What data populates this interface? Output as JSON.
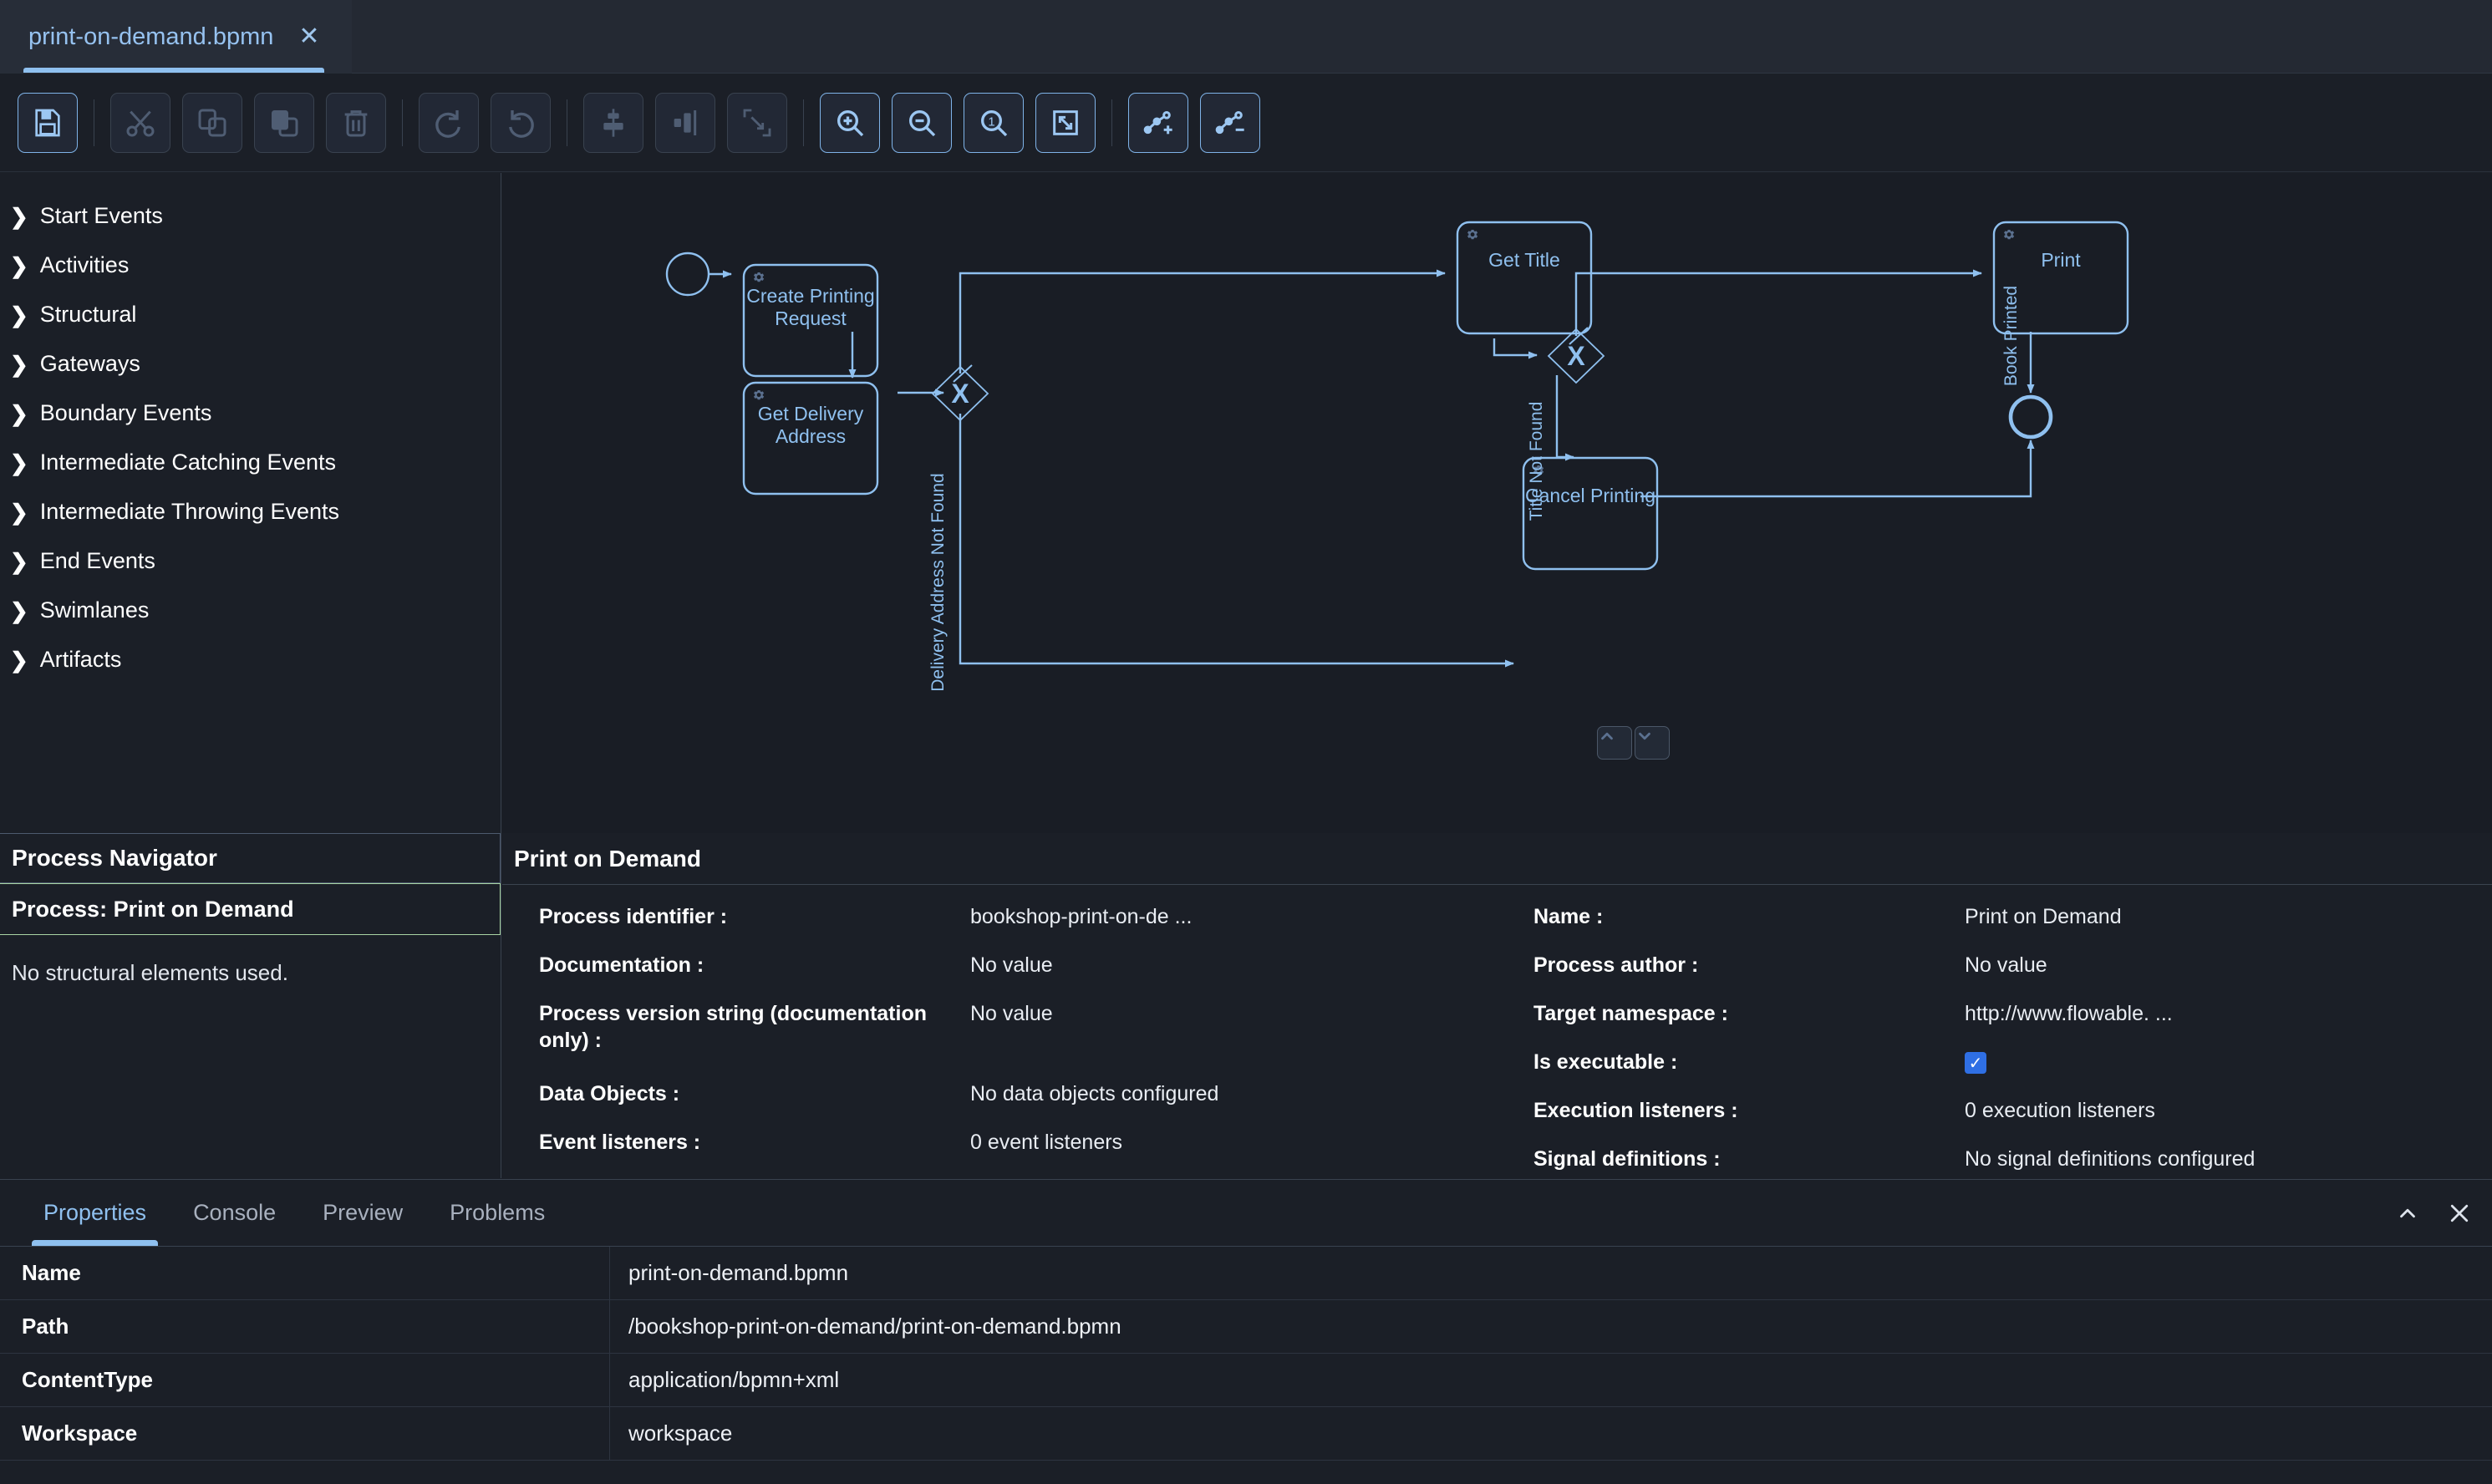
{
  "editor_tab": {
    "filename": "print-on-demand.bpmn",
    "close_icon": "close-icon"
  },
  "toolbar": {
    "buttons": [
      {
        "name": "save-button",
        "icon": "save-floppy-icon",
        "accent": true
      },
      {
        "name": "cut-button",
        "icon": "scissors-icon",
        "accent": false
      },
      {
        "name": "copy-button",
        "icon": "copy-icon",
        "accent": false
      },
      {
        "name": "paste-button",
        "icon": "paste-icon",
        "accent": false
      },
      {
        "name": "delete-button",
        "icon": "trash-icon",
        "accent": false
      },
      {
        "name": "redo-button",
        "icon": "redo-arrow-icon",
        "accent": false
      },
      {
        "name": "undo-button",
        "icon": "undo-arrow-icon",
        "accent": false
      },
      {
        "name": "align-vertical-button",
        "icon": "align-vertical-icon",
        "accent": false
      },
      {
        "name": "align-horizontal-button",
        "icon": "align-horizontal-icon",
        "accent": false
      },
      {
        "name": "resize-button",
        "icon": "resize-diagonal-icon",
        "accent": false
      },
      {
        "name": "zoom-in-button",
        "icon": "magnifier-plus-icon",
        "accent": true
      },
      {
        "name": "zoom-out-button",
        "icon": "magnifier-minus-icon",
        "accent": true
      },
      {
        "name": "zoom-actual-button",
        "icon": "magnifier-one-icon",
        "accent": true
      },
      {
        "name": "zoom-fit-button",
        "icon": "fit-to-screen-icon",
        "accent": true
      },
      {
        "name": "add-bendpoint-button",
        "icon": "node-plus-icon",
        "accent": true
      },
      {
        "name": "remove-bendpoint-button",
        "icon": "node-minus-icon",
        "accent": true
      }
    ]
  },
  "palette": {
    "items": [
      {
        "label": "Start Events"
      },
      {
        "label": "Activities"
      },
      {
        "label": "Structural"
      },
      {
        "label": "Gateways"
      },
      {
        "label": "Boundary Events"
      },
      {
        "label": "Intermediate Catching Events"
      },
      {
        "label": "Intermediate Throwing Events"
      },
      {
        "label": "End Events"
      },
      {
        "label": "Swimlanes"
      },
      {
        "label": "Artifacts"
      }
    ]
  },
  "navigator": {
    "header": "Process Navigator",
    "selected": "Process: Print on Demand",
    "empty_message": "No structural elements used."
  },
  "diagram": {
    "nodes": [
      {
        "id": "start",
        "type": "start-event",
        "label": ""
      },
      {
        "id": "create-printing-request",
        "type": "service-task",
        "label": "Create Printing\nRequest"
      },
      {
        "id": "get-delivery-address",
        "type": "service-task",
        "label": "Get Delivery\nAddress"
      },
      {
        "id": "gw-delivery",
        "type": "exclusive-gateway",
        "label": "X"
      },
      {
        "id": "get-title",
        "type": "service-task",
        "label": "Get Title"
      },
      {
        "id": "gw-title",
        "type": "exclusive-gateway",
        "label": "X"
      },
      {
        "id": "print",
        "type": "service-task",
        "label": "Print"
      },
      {
        "id": "cancel-printing",
        "type": "service-task",
        "label": "Cancel Printing"
      },
      {
        "id": "end",
        "type": "end-event",
        "label": ""
      }
    ],
    "flow_labels": [
      {
        "id": "delivery-address-not-found",
        "text": "Delivery Address Not Found"
      },
      {
        "id": "title-not-found",
        "text": "Title Not Found"
      },
      {
        "id": "book-printed",
        "text": "Book Printed"
      }
    ],
    "scroll_controls": [
      {
        "name": "scroll-up-button",
        "icon": "chevron-up-icon"
      },
      {
        "name": "scroll-down-button",
        "icon": "chevron-down-icon"
      }
    ]
  },
  "element_properties": {
    "title": "Print on Demand",
    "left_column": [
      {
        "key": "Process identifier :",
        "value": "bookshop-print-on-de ..."
      },
      {
        "key": "Documentation :",
        "value": "No value"
      },
      {
        "key": "Process version string (documentation only) :",
        "value": "No value"
      },
      {
        "key": "Data Objects :",
        "value": "No data objects configured"
      },
      {
        "key": "Event listeners :",
        "value": "0 event listeners"
      }
    ],
    "right_column": [
      {
        "key": "Name :",
        "value": "Print on Demand"
      },
      {
        "key": "Process author :",
        "value": "No value"
      },
      {
        "key": "Target namespace :",
        "value": "http://www.flowable. ..."
      },
      {
        "key": "Is executable :",
        "value": "",
        "checkbox": true,
        "checked": true
      },
      {
        "key": "Execution listeners :",
        "value": "0 execution listeners"
      },
      {
        "key": "Signal definitions :",
        "value": "No signal definitions configured"
      }
    ]
  },
  "bottom_panel": {
    "tabs": [
      {
        "label": "Properties",
        "active": true
      },
      {
        "label": "Console",
        "active": false
      },
      {
        "label": "Preview",
        "active": false
      },
      {
        "label": "Problems",
        "active": false
      }
    ],
    "actions": [
      {
        "name": "collapse-panel-button",
        "icon": "chevron-up-icon"
      },
      {
        "name": "close-panel-button",
        "icon": "close-icon"
      }
    ],
    "rows": [
      {
        "key": "Name",
        "value": "print-on-demand.bpmn"
      },
      {
        "key": "Path",
        "value": "/bookshop-print-on-demand/print-on-demand.bpmn"
      },
      {
        "key": "ContentType",
        "value": "application/bpmn+xml"
      },
      {
        "key": "Workspace",
        "value": "workspace"
      }
    ]
  },
  "colors": {
    "accent_blue": "#8fc0ef",
    "diagram_stroke": "#8fc0ef",
    "selection_green": "#a9d5a4",
    "checkbox_blue": "#2f6fe4",
    "panel_bg": "#1b1f27"
  }
}
